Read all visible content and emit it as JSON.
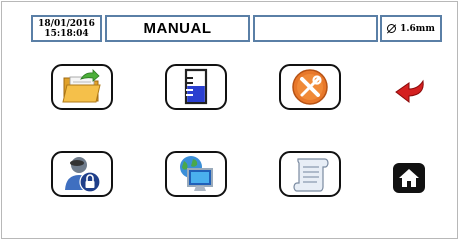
{
  "status_bar": {
    "date": "18/01/2016",
    "time": "15:18:04",
    "mode": "MANUAL",
    "info": "",
    "diameter": "1.6mm"
  },
  "tiles": [
    {
      "icon": "open-folder-icon"
    },
    {
      "icon": "beaker-icon"
    },
    {
      "icon": "tools-icon"
    },
    {
      "icon": "user-lock-icon"
    },
    {
      "icon": "network-computer-icon"
    },
    {
      "icon": "scroll-icon"
    }
  ],
  "nav": {
    "back_icon": "back-arrow-icon",
    "home_icon": "home-icon"
  },
  "colors": {
    "border": "#5a7fa6",
    "back_arrow": "#d42020",
    "tools_badge": "#e8782a"
  }
}
